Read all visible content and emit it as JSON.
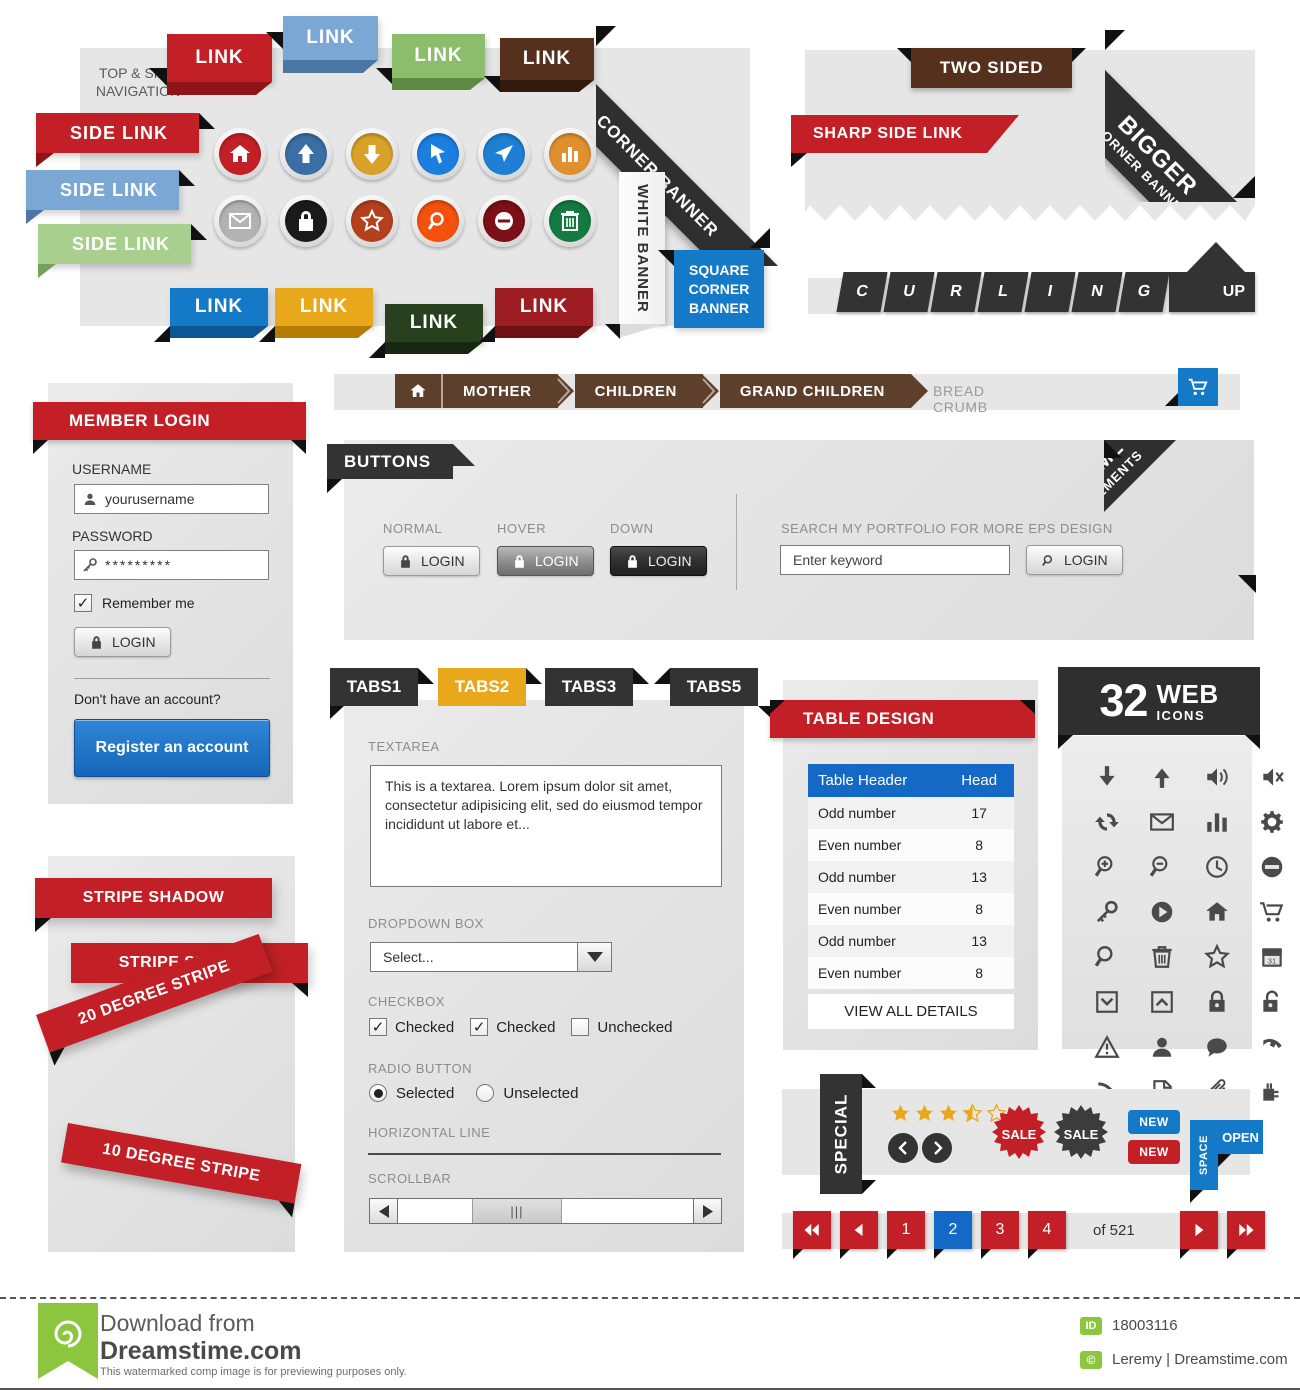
{
  "sections": {
    "nav_title": "TOP & SIDE\nNAVIGATION",
    "nav_title_l1": "TOP & SIDE",
    "nav_title_l2": "NAVIGATION"
  },
  "top_links": [
    {
      "label": "LINK",
      "color": "#c22026",
      "dark": "#8e1418"
    },
    {
      "label": "LINK",
      "color": "#7aa7d4",
      "dark": "#4a77a4"
    },
    {
      "label": "LINK",
      "color": "#8cbd6d",
      "dark": "#5d8a42"
    },
    {
      "label": "LINK",
      "color": "#55301d",
      "dark": "#341a0d"
    }
  ],
  "side_links": [
    {
      "label": "SIDE LINK",
      "color": "#c22026",
      "dark": "#8e1418"
    },
    {
      "label": "SIDE LINK",
      "color": "#7aa7d4",
      "dark": "#4a77a4"
    },
    {
      "label": "SIDE LINK",
      "color": "#a8cf8d",
      "dark": "#78a05d"
    }
  ],
  "bottom_links": [
    {
      "label": "LINK",
      "color": "#1479c6",
      "dark": "#0d5593"
    },
    {
      "label": "LINK",
      "color": "#e9a81c",
      "dark": "#b47d06"
    },
    {
      "label": "LINK",
      "color": "#27411f",
      "dark": "#16280f"
    },
    {
      "label": "LINK",
      "color": "#9e1d22",
      "dark": "#6d1115"
    }
  ],
  "circle_buttons": [
    {
      "icon": "home-icon",
      "color": "#c22026"
    },
    {
      "icon": "arrow-up-icon",
      "color": "#3a6ea5"
    },
    {
      "icon": "arrow-down-icon",
      "color": "#d7a227"
    },
    {
      "icon": "cursor-icon",
      "color": "#1b7fe0"
    },
    {
      "icon": "paper-plane-icon",
      "color": "#1e7fd4"
    },
    {
      "icon": "bar-chart-icon",
      "color": "#e0912e"
    },
    {
      "icon": "mail-icon",
      "color": "#b3b3b3"
    },
    {
      "icon": "lock-icon",
      "color": "#1a1a1a"
    },
    {
      "icon": "star-icon",
      "color": "#b5401d"
    },
    {
      "icon": "search-icon",
      "color": "#f4510d"
    },
    {
      "icon": "block-icon",
      "color": "#7c1017"
    },
    {
      "icon": "trash-icon",
      "color": "#147a40"
    }
  ],
  "banners": {
    "corner_banner": "CORNER BANNER",
    "white_banner": "WHITE BANNER",
    "square_corner_banner_l1": "SQUARE",
    "square_corner_banner_l2": "CORNER",
    "square_corner_banner_l3": "BANNER",
    "two_sided": "TWO SIDED",
    "sharp_side_link": "SHARP SIDE LINK",
    "bigger_l1": "BIGGER",
    "bigger_l2": "CORNER BANNER",
    "curling_letters": [
      "C",
      "U",
      "R",
      "L",
      "I",
      "N",
      "G"
    ],
    "curling_up": "UP"
  },
  "breadcrumb": {
    "home_icon": "home-icon",
    "items": [
      "MOTHER",
      "CHILDREN",
      "GRAND CHILDREN"
    ],
    "label": "BREAD CRUMB",
    "cart_icon": "cart-icon"
  },
  "login": {
    "title": "MEMBER LOGIN",
    "username_label": "USERNAME",
    "username_value": "yourusername",
    "password_label": "PASSWORD",
    "password_value": "*********",
    "remember_label": "Remember me",
    "login_button": "LOGIN",
    "no_account_text": "Don't have an account?",
    "register_button": "Register an account"
  },
  "buttons_panel": {
    "title": "BUTTONS",
    "states": [
      {
        "state": "NORMAL",
        "label": "LOGIN"
      },
      {
        "state": "HOVER",
        "label": "LOGIN"
      },
      {
        "state": "DOWN",
        "label": "LOGIN"
      }
    ],
    "search_label": "SEARCH MY PORTFOLIO FOR MORE EPS DESIGN",
    "search_placeholder": "Enter keyword",
    "search_button": "LOGIN",
    "corner_l1": "HTML",
    "corner_l2": "ELEMENTS"
  },
  "tabs": [
    {
      "label": "TABS1",
      "active": false
    },
    {
      "label": "TABS2",
      "active": true
    },
    {
      "label": "TABS3",
      "active": false
    },
    {
      "label": "TABS5",
      "active": false
    }
  ],
  "form": {
    "textarea_label": "TEXTAREA",
    "textarea_value": "This is a textarea. Lorem ipsum dolor sit amet, consectetur adipisicing elit, sed do eiusmod tempor incididunt ut labore et...",
    "dropdown_label": "DROPDOWN BOX",
    "dropdown_value": "Select...",
    "checkbox_label": "CHECKBOX",
    "checkboxes": [
      {
        "label": "Checked",
        "checked": true
      },
      {
        "label": "Checked",
        "checked": true
      },
      {
        "label": "Unchecked",
        "checked": false
      }
    ],
    "radio_label": "RADIO BUTTON",
    "radios": [
      {
        "label": "Selected",
        "selected": true
      },
      {
        "label": "Unselected",
        "selected": false
      }
    ],
    "hline_label": "HORIZONTAL LINE",
    "scrollbar_label": "SCROLLBAR"
  },
  "stripes": [
    {
      "label": "STRIPE SHADOW"
    },
    {
      "label": "STRIPE SHADOW"
    },
    {
      "label": "20 DEGREE STRIPE"
    },
    {
      "label": "10 DEGREE STRIPE"
    }
  ],
  "table": {
    "title": "TABLE DESIGN",
    "headers": [
      "Table Header",
      "Head"
    ],
    "rows": [
      {
        "label": "Odd number",
        "value": "17"
      },
      {
        "label": "Even number",
        "value": "8"
      },
      {
        "label": "Odd number",
        "value": "13"
      },
      {
        "label": "Even number",
        "value": "8"
      },
      {
        "label": "Odd number",
        "value": "13"
      },
      {
        "label": "Even number",
        "value": "8"
      }
    ],
    "footer": "VIEW ALL DETAILS"
  },
  "web_icons": {
    "count": "32",
    "word_web": "WEB",
    "word_icons": "ICONS",
    "items": [
      "download-icon",
      "upload-icon",
      "volume-on-icon",
      "volume-mute-icon",
      "refresh-icon",
      "mail-icon",
      "bar-chart-icon",
      "gear-icon",
      "zoom-in-icon",
      "zoom-out-icon",
      "clock-icon",
      "block-icon",
      "key-icon",
      "play-icon",
      "home-icon",
      "cart-icon",
      "search-icon",
      "trash-icon",
      "star-icon",
      "calendar-icon",
      "chevron-down-box-icon",
      "chevron-up-box-icon",
      "lock-icon",
      "unlock-icon",
      "warning-icon",
      "user-icon",
      "comment-icon",
      "phone-icon",
      "rss-icon",
      "document-icon",
      "paperclip-icon",
      "plug-icon"
    ]
  },
  "special": {
    "title": "SPECIAL",
    "rating": 3.5,
    "stars_total": 5,
    "prev_icon": "chevron-left-icon",
    "next_icon": "chevron-right-icon",
    "sale_red": "SALE",
    "sale_dark": "SALE",
    "new_blue": "NEW",
    "new_red": "NEW",
    "space_label": "SPACE",
    "open_label": "OPEN"
  },
  "pagination": {
    "first_icon": "double-left-icon",
    "prev_icon": "left-icon",
    "pages": [
      "1",
      "2",
      "3",
      "4"
    ],
    "active_page": "2",
    "of_text": "of 521",
    "next_icon": "right-icon",
    "last_icon": "double-right-icon"
  },
  "footer": {
    "download_from": "Download from",
    "site": "Dreamstime.com",
    "disclaimer": "This watermarked comp image is for previewing purposes only.",
    "id_badge": "ID",
    "id_value": "18003116",
    "copy_badge": "©",
    "author": "Leremy | Dreamstime.com"
  },
  "colors": {
    "red": "#c22026",
    "blue": "#1469c7",
    "orange": "#e9a81c",
    "dark": "#333333",
    "brown": "#5e3f2b",
    "green": "#8cbd6d"
  }
}
